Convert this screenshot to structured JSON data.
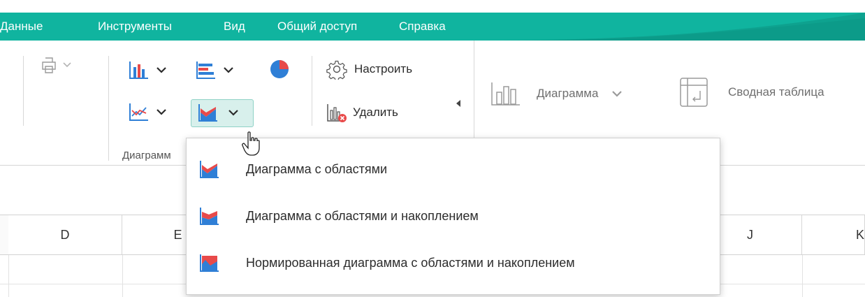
{
  "menubar": {
    "items": [
      "Данные",
      "Инструменты",
      "Вид",
      "Общий доступ",
      "Справка"
    ]
  },
  "ribbon": {
    "configure_label": "Настроить",
    "delete_label": "Удалить",
    "chart_label": "Диаграмма",
    "pivot_label": "Сводная таблица",
    "group_label": "Диаграмм"
  },
  "columns": [
    "D",
    "E",
    "J",
    "K"
  ],
  "dropdown": {
    "items": [
      {
        "label": "Диаграмма с областями",
        "icon": "area-chart-icon"
      },
      {
        "label": "Диаграмма с областями и накоплением",
        "icon": "stacked-area-chart-icon"
      },
      {
        "label": "Нормированная диаграмма с областями и накоплением",
        "icon": "percent-stacked-area-chart-icon"
      }
    ]
  },
  "colors": {
    "accent": "#10b49f",
    "chart_blue": "#2f7fd6",
    "chart_red": "#e84a4a"
  }
}
